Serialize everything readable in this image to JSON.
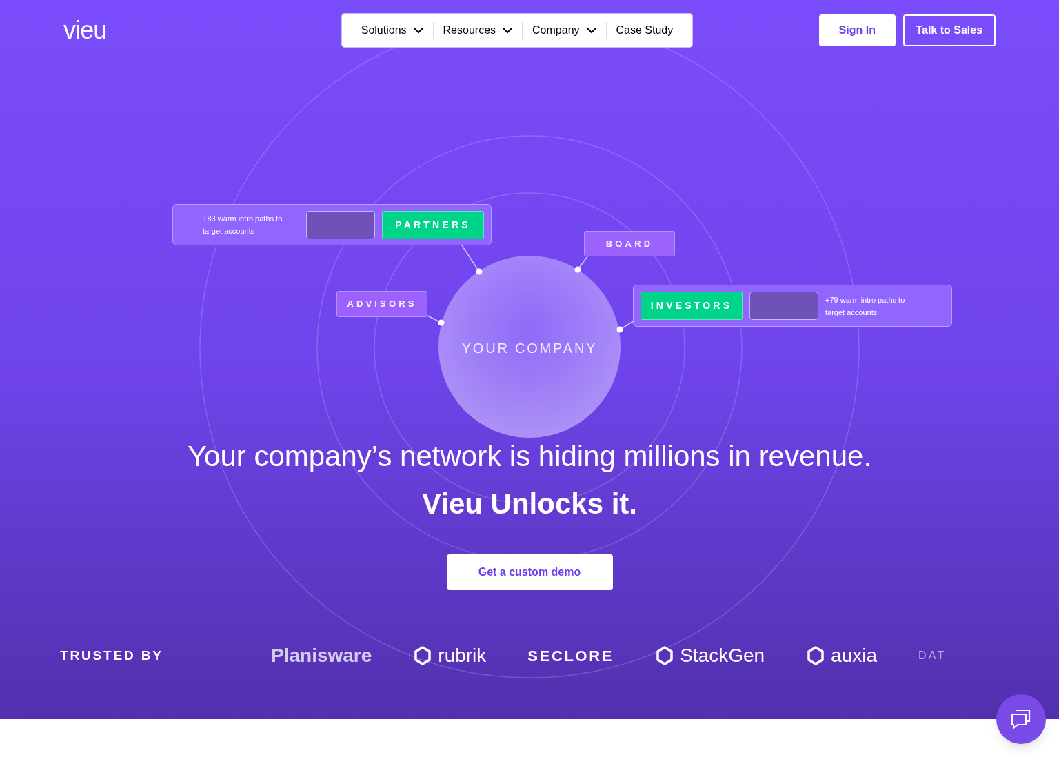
{
  "header": {
    "logo": "vieu",
    "nav": [
      {
        "label": "Solutions",
        "dropdown": true
      },
      {
        "label": "Resources",
        "dropdown": true
      },
      {
        "label": "Company",
        "dropdown": true
      },
      {
        "label": "Case Study",
        "dropdown": false
      }
    ],
    "buttons": [
      {
        "label": "Sign In",
        "kind": "solid"
      },
      {
        "label": "Talk to Sales",
        "kind": "outline"
      }
    ]
  },
  "diagram": {
    "center": "YOUR COMPANY",
    "nodes": [
      {
        "kind": "card",
        "label": "PARTNERS",
        "note": "+83 warm intro paths to target accounts"
      },
      {
        "kind": "tag",
        "label": "BOARD"
      },
      {
        "kind": "tag",
        "label": "ADVISORS"
      },
      {
        "kind": "card-reversed",
        "label": "INVESTORS",
        "note": "+79 warm intro paths to target accounts"
      }
    ]
  },
  "hero": {
    "headline": "Your company’s network is hiding millions in revenue.",
    "subheadline": "Vieu Unlocks it.",
    "cta": "Get a custom demo"
  },
  "trusted": {
    "label": "TRUSTED BY",
    "logos": [
      {
        "text": "Planisware",
        "kind": "serif"
      },
      {
        "text": "rubrik",
        "kind": "icon"
      },
      {
        "text": "SECLORE",
        "kind": "wide"
      },
      {
        "text": "StackGen",
        "kind": "icon"
      },
      {
        "text": "auxia",
        "kind": "icon"
      },
      {
        "text": "DAT",
        "kind": "faded"
      }
    ]
  }
}
